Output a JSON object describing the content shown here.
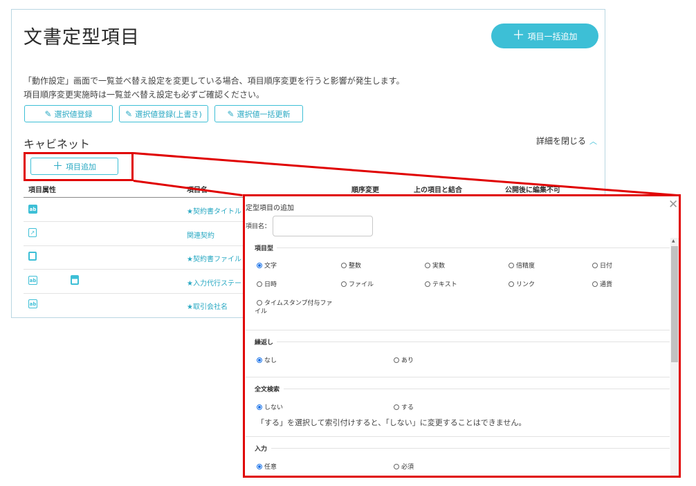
{
  "page": {
    "title": "文書定型項目",
    "bulk_add_label": "項目一括追加",
    "notice_line1": "「動作設定」画面で一覧並べ替え設定を変更している場合、項目順序変更を行うと影響が発生します。",
    "notice_line2": "項目順序変更実施時は一覧並べ替え設定も必ずご確認ください。",
    "buttons": {
      "register": "選択値登録",
      "register_overwrite": "選択値登録(上書き)",
      "bulk_update": "選択値一括更新"
    },
    "section": "キャビネット",
    "collapse_label": "詳細を閉じる",
    "add_item_label": "項目追加"
  },
  "table": {
    "headers": [
      "項目属性",
      "項目名",
      "順序変更",
      "上の項目と結合",
      "公開後に編集不可"
    ],
    "rows": [
      {
        "icon": "text-field-icon",
        "name": "★契約書タイトル"
      },
      {
        "icon": "link-icon",
        "name": "関連契約"
      },
      {
        "icon": "file-icon",
        "name": "★契約書ファイル"
      },
      {
        "icon": "text-field-icon",
        "name": "★入力代行ステー"
      },
      {
        "icon": "text-field-icon",
        "name": "★取引会社名"
      }
    ]
  },
  "modal": {
    "title": "定型項目の追加",
    "name_label": "項目名：",
    "name_value": "",
    "type_heading": "項目型",
    "type_options": [
      "文字",
      "整数",
      "実数",
      "倍精度",
      "日付",
      "日時",
      "ファイル",
      "テキスト",
      "リンク",
      "通貨",
      "タイムスタンプ付与ファ",
      "イル"
    ],
    "repeat_heading": "繰返し",
    "repeat_options": [
      "なし",
      "あり"
    ],
    "search_heading": "全文検索",
    "search_options": [
      "しない",
      "する"
    ],
    "search_note": "「する」を選択して索引付けすると、「しない」に変更することはできません。",
    "input_heading": "入力",
    "input_options": [
      "任意",
      "必須"
    ]
  },
  "colors": {
    "accent": "#3dbfd6",
    "highlight": "#e00000",
    "radio_selected": "#1a73e8"
  }
}
